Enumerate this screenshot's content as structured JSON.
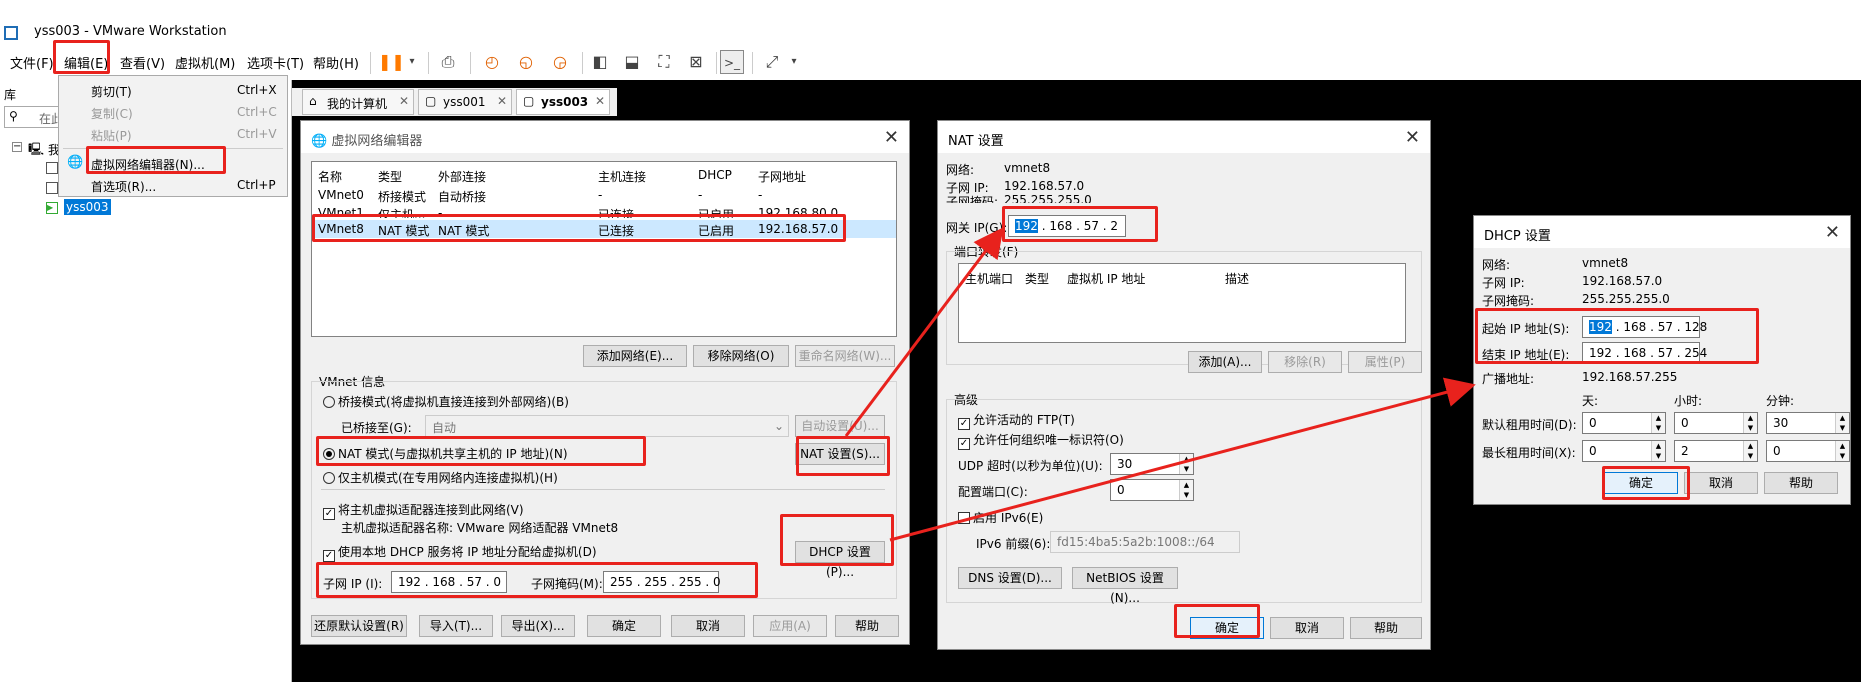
{
  "app": {
    "title": "yss003 - VMware Workstation"
  },
  "menubar": {
    "file": "文件(F)",
    "edit": "编辑(E)",
    "view": "查看(V)",
    "vm": "虚拟机(M)",
    "tabs": "选项卡(T)",
    "help": "帮助(H)"
  },
  "library": {
    "title": "库",
    "search": "在此",
    "tree": [
      "我",
      "",
      ""
    ],
    "selected": "yss003"
  },
  "edit_menu": {
    "items": [
      {
        "label": "剪切(T)",
        "shortcut": "Ctrl+X"
      },
      {
        "label": "复制(C)",
        "shortcut": "Ctrl+C"
      },
      {
        "label": "粘贴(P)",
        "shortcut": "Ctrl+V"
      },
      {
        "label": "虚拟网络编辑器(N)...",
        "shortcut": ""
      },
      {
        "label": "首选项(R)...",
        "shortcut": "Ctrl+P"
      }
    ]
  },
  "tabs": [
    "我的计算机",
    "yss001",
    "yss003"
  ],
  "vne": {
    "title": "虚拟网络编辑器",
    "columns": [
      "名称",
      "类型",
      "外部连接",
      "主机连接",
      "DHCP",
      "子网地址"
    ],
    "rows": [
      [
        "VMnet0",
        "桥接模式",
        "自动桥接",
        "-",
        "-",
        "-"
      ],
      [
        "VMnet1",
        "仅主机...",
        "-",
        "已连接",
        "已启用",
        "192.168.80.0"
      ],
      [
        "VMnet8",
        "NAT 模式",
        "NAT 模式",
        "已连接",
        "已启用",
        "192.168.57.0"
      ]
    ],
    "add_network": "添加网络(E)...",
    "remove_network": "移除网络(O)",
    "rename_network": "重命名网络(W)...",
    "vmnet_info": "VMnet 信息",
    "bridge_mode": "桥接模式(将虚拟机直接连接到外部网络)(B)",
    "bridged_to": "已桥接至(G):",
    "bridged_value": "自动",
    "auto_settings": "自动设置(U)...",
    "nat_mode": "NAT 模式(与虚拟机共享主机的 IP 地址)(N)",
    "nat_settings": "NAT 设置(S)...",
    "host_only": "仅主机模式(在专用网络内连接虚拟机)(H)",
    "connect_adapter": "将主机虚拟适配器连接到此网络(V)",
    "adapter_name": "主机虚拟适配器名称: VMware 网络适配器 VMnet8",
    "use_dhcp": "使用本地 DHCP 服务将 IP 地址分配给虚拟机(D)",
    "dhcp_settings": "DHCP 设置(P)...",
    "subnet_ip_label": "子网 IP (I):",
    "subnet_ip": "192 . 168 . 57 . 0",
    "subnet_mask_label": "子网掩码(M):",
    "subnet_mask": "255 . 255 . 255 . 0",
    "restore": "还原默认设置(R)",
    "import": "导入(T)...",
    "export": "导出(X)...",
    "ok": "确定",
    "cancel": "取消",
    "apply": "应用(A)",
    "help": "帮助"
  },
  "nat": {
    "title": "NAT 设置",
    "network_label": "网络:",
    "network": "vmnet8",
    "subnet_ip_label": "子网 IP:",
    "subnet_ip": "192.168.57.0",
    "subnet_mask_label": "子网掩码:",
    "subnet_mask": "255.255.255.0",
    "gateway_label": "网关 IP(G):",
    "gw1": "192",
    "gw_rest": " . 168 . 57 . 2",
    "port_forward": "端口转发(F)",
    "pf_columns": [
      "主机端口",
      "类型",
      "虚拟机 IP 地址",
      "描述"
    ],
    "add": "添加(A)...",
    "remove": "移除(R)",
    "properties": "属性(P)",
    "advanced": "高级",
    "allow_ftp": "允许活动的 FTP(T)",
    "allow_oui": "允许任何组织唯一标识符(O)",
    "udp_label": "UDP 超时(以秒为单位)(U):",
    "udp_value": "30",
    "config_port_label": "配置端口(C):",
    "config_port_value": "0",
    "enable_ipv6": "启用 IPv6(E)",
    "ipv6_label": "IPv6 前缀(6):",
    "ipv6_value": "fd15:4ba5:5a2b:1008::/64",
    "dns": "DNS 设置(D)...",
    "netbios": "NetBIOS 设置(N)...",
    "ok": "确定",
    "cancel": "取消",
    "help": "帮助"
  },
  "dhcp": {
    "title": "DHCP 设置",
    "network_label": "网络:",
    "network": "vmnet8",
    "subnet_ip_label": "子网 IP:",
    "subnet_ip": "192.168.57.0",
    "subnet_mask_label": "子网掩码:",
    "subnet_mask": "255.255.255.0",
    "start_label": "起始 IP 地址(S):",
    "start1": "192",
    "start_rest": " . 168 . 57 . 128",
    "end_label": "结束 IP 地址(E):",
    "end_value": "192 . 168 . 57 . 254",
    "broadcast_label": "广播地址:",
    "broadcast": "192.168.57.255",
    "day": "天:",
    "hour": "小时:",
    "minute": "分钟:",
    "default_lease": "默认租用时间(D):",
    "default": [
      "0",
      "0",
      "30"
    ],
    "max_lease": "最长租用时间(X):",
    "max": [
      "0",
      "2",
      "0"
    ],
    "ok": "确定",
    "cancel": "取消",
    "help": "帮助"
  },
  "colors": {
    "annotation": "#e8221d",
    "selection": "#0078d7"
  }
}
